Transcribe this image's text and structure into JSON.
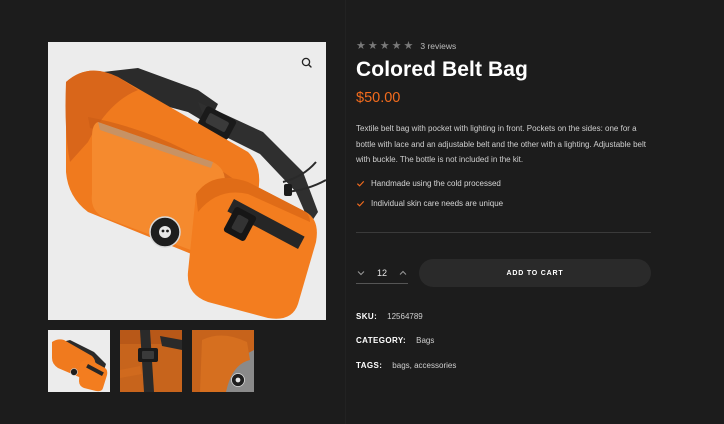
{
  "gallery": {
    "zoom_icon": "magnifier-icon",
    "thumbnails": [
      "thumbnail-1",
      "thumbnail-2",
      "thumbnail-3"
    ]
  },
  "product": {
    "rating": {
      "stars_filled": 0,
      "stars_total": 5,
      "reviews_label": "3 reviews"
    },
    "title": "Colored Belt Bag",
    "price": "$50.00",
    "description": "Textile belt bag with pocket with lighting in front. Pockets on the sides: one for a bottle  with lace and an adjustable belt and the other with a lighting. Adjustable belt with buckle. The bottle is not included in the kit.",
    "features": [
      "Handmade using the cold processed",
      "Individual skin care needs are unique"
    ],
    "quantity": "12",
    "add_to_cart_label": "ADD TO CART",
    "meta": {
      "sku_label": "SKU:",
      "sku_value": "12564789",
      "category_label": "CATEGORY:",
      "category_value": "Bags",
      "tags_label": "TAGS:",
      "tags_value": "bags, accessories"
    }
  },
  "colors": {
    "background": "#1c1c1c",
    "accent": "#f26b1d",
    "button_bg": "#2a2a2a",
    "product_orange": "#f07a1e"
  }
}
